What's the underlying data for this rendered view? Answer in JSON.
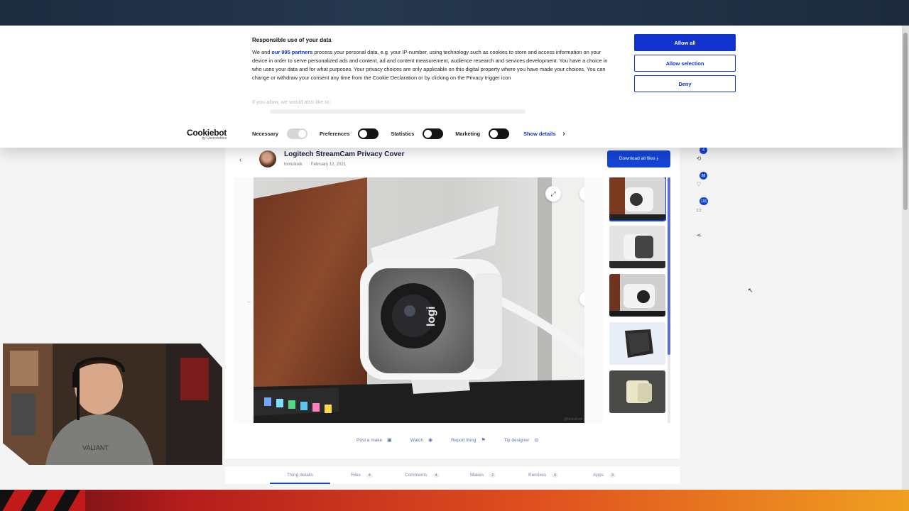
{
  "cookie": {
    "title": "Responsible use of your data",
    "text_before_link": "We and ",
    "link": "our 995 partners",
    "text_after_link": " process your personal data, e.g. your IP-number, using technology such as cookies to store and access information on your device in order to serve personalized ads and content, ad and content measurement, audience research and services development. You have a choice in who uses your data and for what purposes. Your privacy choices are only applicable on this digital property where you have made your choices. You can change or withdraw your consent any time from the Cookie Declaration or by clicking on the Privacy trigger icon",
    "faded": "If you allow, we would also like to:",
    "buttons": {
      "allow_all": "Allow all",
      "allow_selection": "Allow selection",
      "deny": "Deny"
    },
    "brand": "Cookiebot",
    "brand_sub": "by Usercentrics",
    "toggles": [
      {
        "label": "Necessary"
      },
      {
        "label": "Preferences"
      },
      {
        "label": "Statistics"
      },
      {
        "label": "Marketing"
      }
    ],
    "show_details": "Show details"
  },
  "thing": {
    "title": "Logitech StreamCam Privacy Cover",
    "author": "tomulinek",
    "date": "February 12, 2021",
    "download_all": "Download all files",
    "watermark": "@tomulinek"
  },
  "actions": [
    {
      "label": "Post a make",
      "icon": "camera-icon"
    },
    {
      "label": "Watch",
      "icon": "eye-icon"
    },
    {
      "label": "Report thing",
      "icon": "flag-icon"
    },
    {
      "label": "Tip designer",
      "icon": "coin-icon"
    }
  ],
  "tabs": [
    {
      "label": "Thing details",
      "count": ""
    },
    {
      "label": "Files",
      "count": "4"
    },
    {
      "label": "Comments",
      "count": "4"
    },
    {
      "label": "Makes",
      "count": "2"
    },
    {
      "label": "Remixes",
      "count": "0"
    },
    {
      "label": "Apps",
      "count": "3"
    }
  ],
  "side_badges": [
    "4",
    "88",
    "191"
  ],
  "colors": {
    "accent": "#1545d6",
    "cookie_blue": "#1032cf"
  }
}
